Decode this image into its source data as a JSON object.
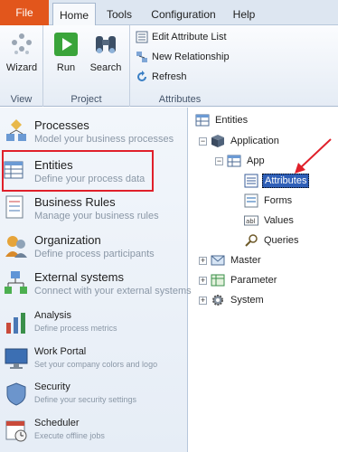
{
  "menu": {
    "file": "File",
    "tabs": [
      "Home",
      "Tools",
      "Configuration",
      "Help"
    ],
    "active_tab": "Home"
  },
  "ribbon": {
    "view_group": {
      "label": "View",
      "wizard": "Wizard"
    },
    "project_group": {
      "label": "Project",
      "run": "Run",
      "search": "Search"
    },
    "attributes_group": {
      "label": "Attributes",
      "edit_attribute_list": "Edit Attribute List",
      "new_relationship": "New Relationship",
      "refresh": "Refresh"
    }
  },
  "nav": {
    "processes": {
      "title": "Processes",
      "sub": "Model your business processes"
    },
    "entities": {
      "title": "Entities",
      "sub": "Define your process data"
    },
    "business_rules": {
      "title": "Business Rules",
      "sub": "Manage your business rules"
    },
    "organization": {
      "title": "Organization",
      "sub": "Define process participants"
    },
    "external_systems": {
      "title": "External systems",
      "sub": "Connect with your external systems"
    },
    "analysis": {
      "title": "Analysis",
      "sub": "Define process metrics"
    },
    "work_portal": {
      "title": "Work Portal",
      "sub": "Set your company colors and logo"
    },
    "security": {
      "title": "Security",
      "sub": "Define your security settings"
    },
    "scheduler": {
      "title": "Scheduler",
      "sub": "Execute offline jobs"
    }
  },
  "tree": {
    "root": "Entities",
    "application": "Application",
    "app": "App",
    "attributes": "Attributes",
    "forms": "Forms",
    "values": "Values",
    "queries": "Queries",
    "master": "Master",
    "parameter": "Parameter",
    "system": "System"
  },
  "colors": {
    "file_menu": "#e2561c",
    "selection": "#2f5fb7",
    "highlight": "#e0202a"
  }
}
